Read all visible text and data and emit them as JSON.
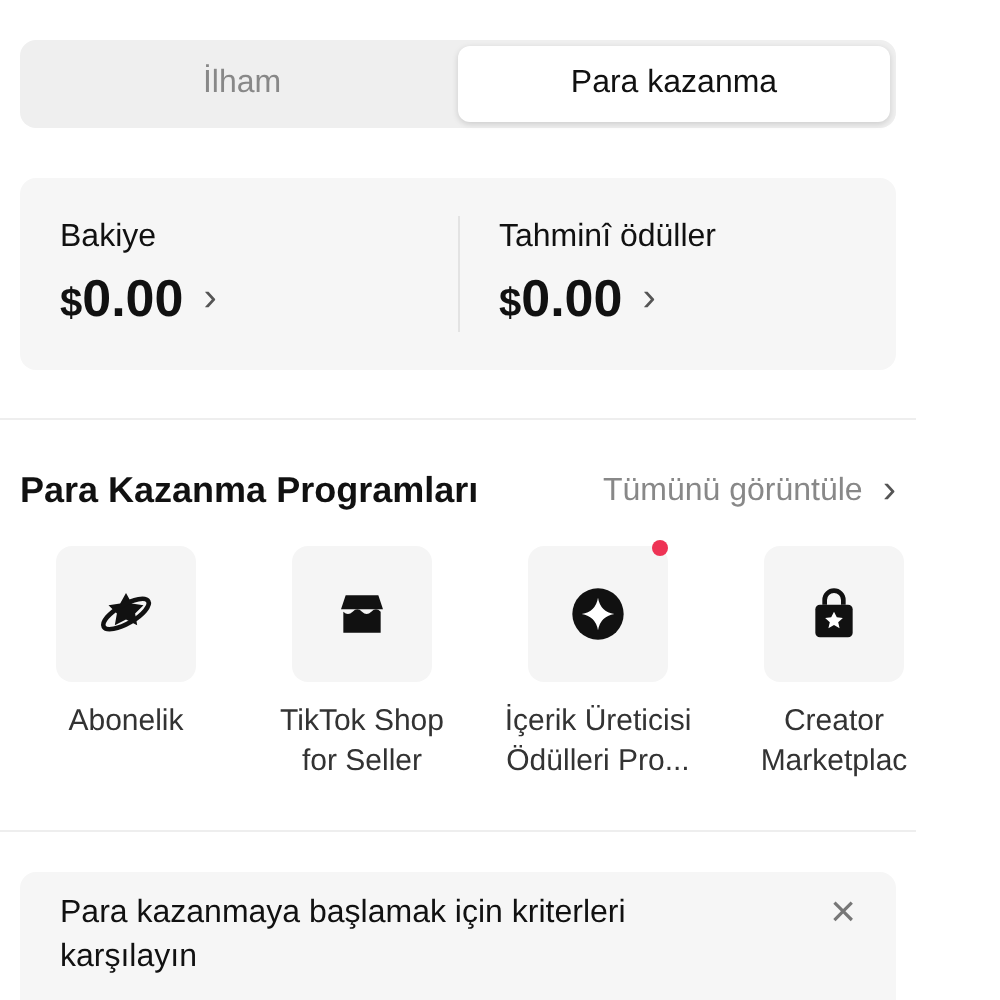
{
  "tabs": [
    {
      "label": "İlham",
      "selected": false
    },
    {
      "label": "Para kazanma",
      "selected": true
    }
  ],
  "balances": [
    {
      "label": "Bakiye",
      "currency": "$",
      "amount": "0.00",
      "chevron": "›"
    },
    {
      "label": "Tahminî ödüller",
      "currency": "$",
      "amount": "0.00",
      "chevron": "›"
    }
  ],
  "programs": {
    "title": "Para Kazanma Programları",
    "view_all": "Tümünü görüntüle",
    "view_all_chevron": "›",
    "items": [
      {
        "kind": "planet",
        "lines": [
          "Abonelik"
        ],
        "new": false
      },
      {
        "kind": "shop",
        "lines": [
          "TikTok Shop",
          "for Seller"
        ],
        "new": false
      },
      {
        "kind": "sparkle",
        "lines": [
          "İçerik Üreticisi",
          "Ödülleri Pro..."
        ],
        "new": true
      },
      {
        "kind": "bag",
        "lines": [
          "Creator",
          "Marketplac"
        ],
        "new": false
      }
    ]
  },
  "banner": {
    "text": "Para kazanmaya başlamak için kriterleri karşılayın",
    "close": "×"
  }
}
